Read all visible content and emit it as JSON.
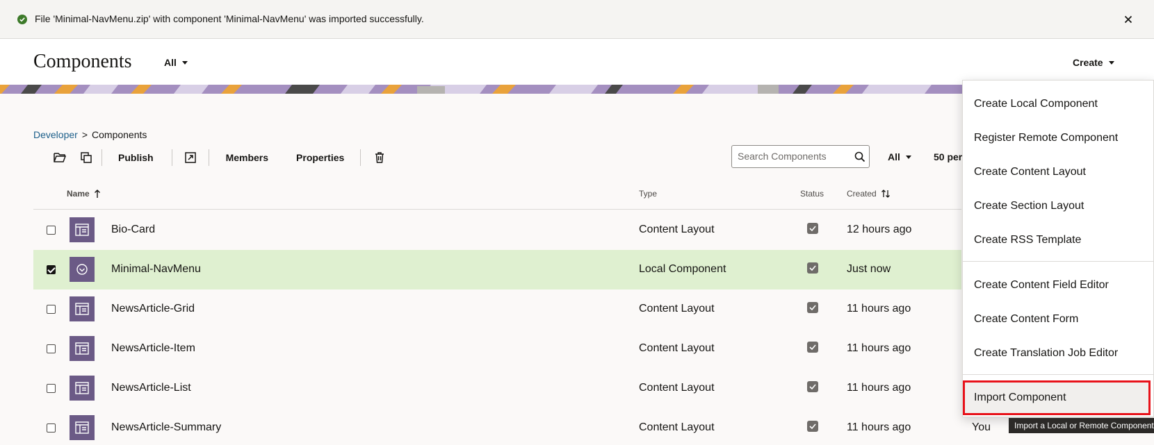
{
  "notification": {
    "message": "File 'Minimal-NavMenu.zip' with component 'Minimal-NavMenu' was imported successfully.",
    "status_icon": "check-circle-icon",
    "status_color": "#3d7a2a",
    "close_icon": "close-icon"
  },
  "header": {
    "title": "Components",
    "filter_label": "All",
    "create_label": "Create"
  },
  "breadcrumb": {
    "parent": "Developer",
    "separator": ">",
    "current": "Components"
  },
  "toolbar": {
    "publish": "Publish",
    "members": "Members",
    "properties": "Properties"
  },
  "search": {
    "placeholder": "Search Components"
  },
  "list_filter": "All",
  "per_page": "50 per",
  "table": {
    "headers": {
      "name": "Name",
      "type": "Type",
      "status": "Status",
      "created": "Created"
    },
    "rows": [
      {
        "name": "Bio-Card",
        "type": "Content Layout",
        "created": "12 hours ago",
        "by": "",
        "selected": false
      },
      {
        "name": "Minimal-NavMenu",
        "type": "Local Component",
        "created": "Just now",
        "by": "",
        "selected": true
      },
      {
        "name": "NewsArticle-Grid",
        "type": "Content Layout",
        "created": "11 hours ago",
        "by": "",
        "selected": false
      },
      {
        "name": "NewsArticle-Item",
        "type": "Content Layout",
        "created": "11 hours ago",
        "by": "",
        "selected": false
      },
      {
        "name": "NewsArticle-List",
        "type": "Content Layout",
        "created": "11 hours ago",
        "by": "",
        "selected": false
      },
      {
        "name": "NewsArticle-Summary",
        "type": "Content Layout",
        "created": "11 hours ago",
        "by": "You",
        "selected": false
      }
    ]
  },
  "create_menu": {
    "items": [
      "Create Local Component",
      "Register Remote Component",
      "Create Content Layout",
      "Create Section Layout",
      "Create RSS Template",
      "Create Content Field Editor",
      "Create Content Form",
      "Create Translation Job Editor",
      "Import Component"
    ],
    "highlight_color": "#e8121a"
  },
  "tooltip": "Import a Local or Remote Component",
  "colors": {
    "selected_row": "#dff0d0",
    "thumbnail": "#6b5a86",
    "link": "#1c5f8a"
  }
}
